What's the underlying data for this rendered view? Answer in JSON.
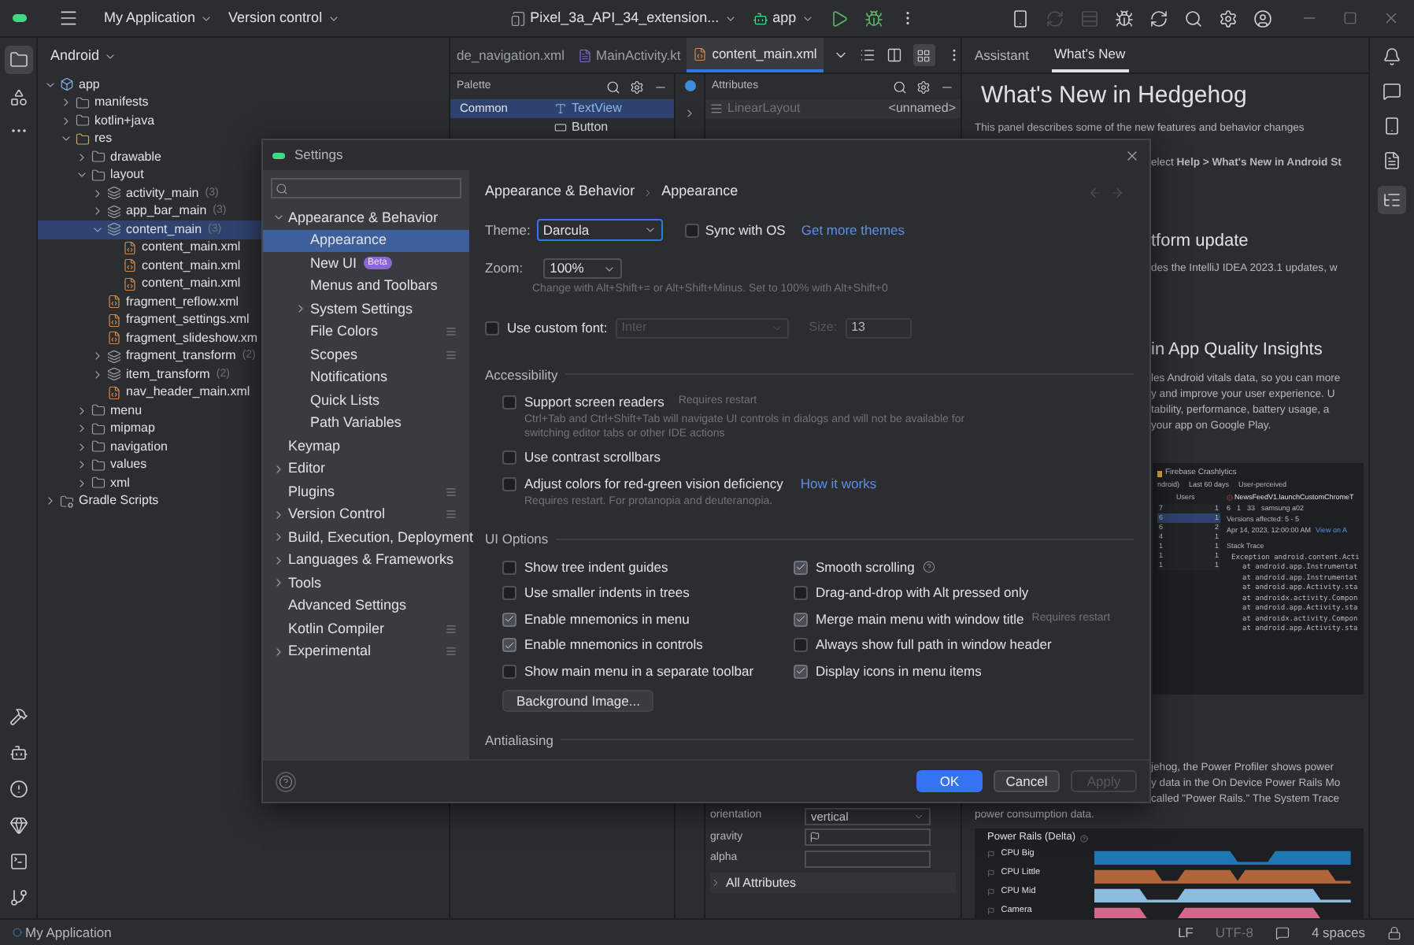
{
  "title_bar": {
    "project": "My Application",
    "vcs": "Version control",
    "device": "Pixel_3a_API_34_extension...",
    "run_config": "app"
  },
  "project_panel": {
    "view": "Android",
    "tree": [
      {
        "label": "app",
        "kind": "module",
        "expanded": true,
        "selected": false,
        "children": [
          {
            "label": "manifests",
            "kind": "folder",
            "expanded": false,
            "selected": false
          },
          {
            "label": "kotlin+java",
            "kind": "folder",
            "expanded": false,
            "selected": false
          },
          {
            "label": "res",
            "kind": "res",
            "expanded": true,
            "selected": false,
            "children": [
              {
                "label": "drawable",
                "kind": "folder",
                "expanded": false,
                "selected": false
              },
              {
                "label": "layout",
                "kind": "folder",
                "expanded": true,
                "selected": false,
                "children": [
                  {
                    "label": "activity_main",
                    "note": "(3)",
                    "kind": "group",
                    "expanded": false,
                    "selected": false
                  },
                  {
                    "label": "app_bar_main",
                    "note": "(3)",
                    "kind": "group",
                    "expanded": false,
                    "selected": false
                  },
                  {
                    "label": "content_main",
                    "note": "(3)",
                    "kind": "group",
                    "expanded": true,
                    "selected": true,
                    "children": [
                      {
                        "label": "content_main.xml",
                        "kind": "xml",
                        "selected": false
                      },
                      {
                        "label": "content_main.xml",
                        "kind": "xml",
                        "selected": false
                      },
                      {
                        "label": "content_main.xml",
                        "kind": "xml",
                        "selected": false
                      }
                    ]
                  },
                  {
                    "label": "fragment_reflow.xml",
                    "kind": "xml",
                    "selected": false
                  },
                  {
                    "label": "fragment_settings.xml",
                    "kind": "xml",
                    "selected": false
                  },
                  {
                    "label": "fragment_slideshow.xm",
                    "kind": "xml",
                    "selected": false
                  },
                  {
                    "label": "fragment_transform",
                    "note": "(2)",
                    "kind": "group",
                    "expanded": false,
                    "selected": false
                  },
                  {
                    "label": "item_transform",
                    "note": "(2)",
                    "kind": "group",
                    "expanded": false,
                    "selected": false
                  },
                  {
                    "label": "nav_header_main.xml",
                    "kind": "xml",
                    "selected": false
                  }
                ]
              },
              {
                "label": "menu",
                "kind": "folder",
                "expanded": false,
                "selected": false
              },
              {
                "label": "mipmap",
                "kind": "folder",
                "expanded": false,
                "selected": false
              },
              {
                "label": "navigation",
                "kind": "folder",
                "expanded": false,
                "selected": false
              },
              {
                "label": "values",
                "kind": "folder",
                "expanded": false,
                "selected": false
              },
              {
                "label": "xml",
                "kind": "folder",
                "expanded": false,
                "selected": false
              }
            ]
          }
        ]
      },
      {
        "label": "Gradle Scripts",
        "kind": "gradle",
        "expanded": false,
        "selected": false
      }
    ]
  },
  "editor_tabs": [
    {
      "label": "de_navigation.xml",
      "kind": "xml",
      "selected": false
    },
    {
      "label": "MainActivity.kt",
      "kind": "kotlin",
      "selected": false
    },
    {
      "label": "content_main.xml",
      "kind": "xml",
      "selected": true
    }
  ],
  "palette": {
    "title": "Palette",
    "categories": [
      {
        "label": "Common",
        "selected": true
      }
    ],
    "widgets": [
      {
        "label": "TextView",
        "kind": "text",
        "selected": true
      },
      {
        "label": "Button",
        "kind": "button",
        "selected": false
      }
    ]
  },
  "attributes": {
    "title": "Attributes",
    "component": "LinearLayout",
    "component_id": "<unnamed>",
    "rows": [
      {
        "name": "orientation",
        "kind": "dropdown",
        "value": "vertical"
      },
      {
        "name": "gravity",
        "kind": "flag"
      },
      {
        "name": "alpha",
        "kind": "field"
      }
    ],
    "all_attributes": "All Attributes"
  },
  "tool_window_tabs": [
    {
      "label": "Assistant",
      "selected": false
    },
    {
      "label": "What's New",
      "selected": true
    }
  ],
  "whats_new": [
    {
      "kind": "title",
      "text": "What's New in Hedgehog"
    },
    {
      "kind": "paragraph",
      "lines": [
        "This panel describes some of the new features and behavior changes"
      ]
    },
    {
      "kind": "covered_paragraph",
      "lines": [
        "elect **Help > What's New in Android St**"
      ]
    },
    {
      "kind": "covered_heading",
      "text": "tform update"
    },
    {
      "kind": "covered_paragraph",
      "lines": [
        "des the IntelliJ IDEA 2023.1 updates, w"
      ]
    },
    {
      "kind": "covered_heading",
      "text": "in App Quality Insights"
    },
    {
      "kind": "covered_paragraph",
      "lines": [
        "les Android vitals data, so you can more",
        "y and improve your user experience. U",
        "tability, performance, battery usage, a",
        "your app on Google Play."
      ]
    },
    {
      "kind": "crashlytics",
      "title": "Firebase Crashlytics",
      "filters": [
        "ndroid)",
        "Last 60 days",
        "User-perceived"
      ],
      "users_header": "Users",
      "rows": [
        {
          "column_1": "7",
          "column_2": "1",
          "selected": false
        },
        {
          "column_1": "6",
          "column_2": "1",
          "selected": true
        },
        {
          "column_1": "6",
          "column_2": "2",
          "selected": false
        },
        {
          "column_1": "4",
          "column_2": "1",
          "selected": false
        },
        {
          "column_1": "1",
          "column_2": "1",
          "selected": false
        },
        {
          "column_1": "1",
          "column_2": "1",
          "selected": false
        },
        {
          "column_1": "1",
          "column_2": "1",
          "selected": false
        }
      ],
      "issue": "NewsFeedV1.launchCustomChromeT",
      "stats": [
        "6",
        "1",
        "33",
        "samsung a02"
      ],
      "versions": "Versions affected: 5 - 5",
      "date": "Apr 14, 2023, 12:00:00 AM",
      "link": "View on A",
      "stack_title": "Stack Trace",
      "stack": [
        "Exception android.content.Acti",
        "at android.app.Instrumentat",
        "at android.app.Instrumentat",
        "at android.app.Activity.sta",
        "at androidx.activity.Compon",
        "at android.app.Activity.sta",
        "at androidx.activity.Compon",
        "at android.app.Activity.sta"
      ]
    },
    {
      "kind": "covered_paragraph",
      "lines": [
        "jehog, the Power Profiler shows power",
        "y data in the On Device Power Rails Mo",
        "called \"Power Rails.\" The System Trace"
      ]
    },
    {
      "kind": "paragraph",
      "lines": [
        "power consumption data."
      ]
    },
    {
      "kind": "power_rails",
      "title": "Power Rails (Delta)",
      "rails": [
        {
          "name": "CPU Big",
          "color": "#1f78b4"
        },
        {
          "name": "CPU Little",
          "color": "#b0663a"
        },
        {
          "name": "CPU Mid",
          "color": "#8cbde0"
        },
        {
          "name": "Camera",
          "color": "#d0698a"
        }
      ]
    }
  ],
  "settings_dialog": {
    "title": "Settings",
    "nav": [
      {
        "label": "Appearance & Behavior",
        "expanded": true,
        "selected": false,
        "children": [
          {
            "label": "Appearance",
            "selected": true
          },
          {
            "label": "New UI",
            "badge": "Beta",
            "selected": false
          },
          {
            "label": "Menus and Toolbars",
            "selected": false
          },
          {
            "label": "System Settings",
            "expanded": false,
            "selected": false
          },
          {
            "label": "File Colors",
            "project": true,
            "selected": false
          },
          {
            "label": "Scopes",
            "project": true,
            "selected": false
          },
          {
            "label": "Notifications",
            "selected": false
          },
          {
            "label": "Quick Lists",
            "selected": false
          },
          {
            "label": "Path Variables",
            "selected": false
          }
        ]
      },
      {
        "label": "Keymap",
        "selected": false
      },
      {
        "label": "Editor",
        "expanded": false,
        "selected": false
      },
      {
        "label": "Plugins",
        "project": true,
        "selected": false
      },
      {
        "label": "Version Control",
        "expanded": false,
        "project": true,
        "selected": false
      },
      {
        "label": "Build, Execution, Deployment",
        "expanded": false,
        "selected": false
      },
      {
        "label": "Languages & Frameworks",
        "expanded": false,
        "selected": false
      },
      {
        "label": "Tools",
        "expanded": false,
        "selected": false
      },
      {
        "label": "Advanced Settings",
        "selected": false
      },
      {
        "label": "Kotlin Compiler",
        "project": true,
        "selected": false
      },
      {
        "label": "Experimental",
        "expanded": false,
        "project": true,
        "selected": false
      }
    ],
    "breadcrumb": [
      "Appearance & Behavior",
      "Appearance"
    ],
    "theme": {
      "label": "Theme:",
      "value": "Darcula",
      "sync_label": "Sync with OS",
      "sync_checked": false,
      "link": "Get more themes"
    },
    "zoom": {
      "label": "Zoom:",
      "value": "100%",
      "hint": "Change with Alt+Shift+= or Alt+Shift+Minus. Set to 100% with Alt+Shift+0"
    },
    "custom_font": {
      "label": "Use custom font:",
      "checked": false,
      "value": "Inter",
      "size_label": "Size:",
      "size": "13"
    },
    "accessibility": {
      "title": "Accessibility",
      "options": [
        {
          "label": "Support screen readers",
          "checked": false,
          "note": "Requires restart",
          "hint": "Ctrl+Tab and Ctrl+Shift+Tab will navigate UI controls in dialogs and will not be available for switching editor tabs or other IDE actions"
        },
        {
          "label": "Use contrast scrollbars",
          "checked": false
        },
        {
          "label": "Adjust colors for red-green vision deficiency",
          "checked": false,
          "link": "How it works",
          "hint": "Requires restart. For protanopia and deuteranopia."
        }
      ]
    },
    "ui_options": {
      "title": "UI Options",
      "left": [
        {
          "label": "Show tree indent guides",
          "checked": false
        },
        {
          "label": "Use smaller indents in trees",
          "checked": false
        },
        {
          "label": "Enable mnemonics in menu",
          "checked": true
        },
        {
          "label": "Enable mnemonics in controls",
          "checked": true
        },
        {
          "label": "Show main menu in a separate toolbar",
          "checked": false
        }
      ],
      "right": [
        {
          "label": "Smooth scrolling",
          "checked": true,
          "help": true
        },
        {
          "label": "Drag-and-drop with Alt pressed only",
          "checked": false
        },
        {
          "label": "Merge main menu with window title",
          "checked": true,
          "note": "Requires restart"
        },
        {
          "label": "Always show full path in window header",
          "checked": false
        },
        {
          "label": "Display icons in menu items",
          "checked": true
        }
      ],
      "button": "Background Image..."
    },
    "next_section": "Antialiasing",
    "buttons": [
      {
        "label": "OK",
        "kind": "primary",
        "disabled": false
      },
      {
        "label": "Cancel",
        "kind": "secondary",
        "disabled": false
      },
      {
        "label": "Apply",
        "kind": "secondary",
        "disabled": true
      }
    ]
  },
  "status_bar": {
    "project": "My Application",
    "line_ending": "LF",
    "encoding": "UTF-8",
    "indent": "4 spaces"
  }
}
